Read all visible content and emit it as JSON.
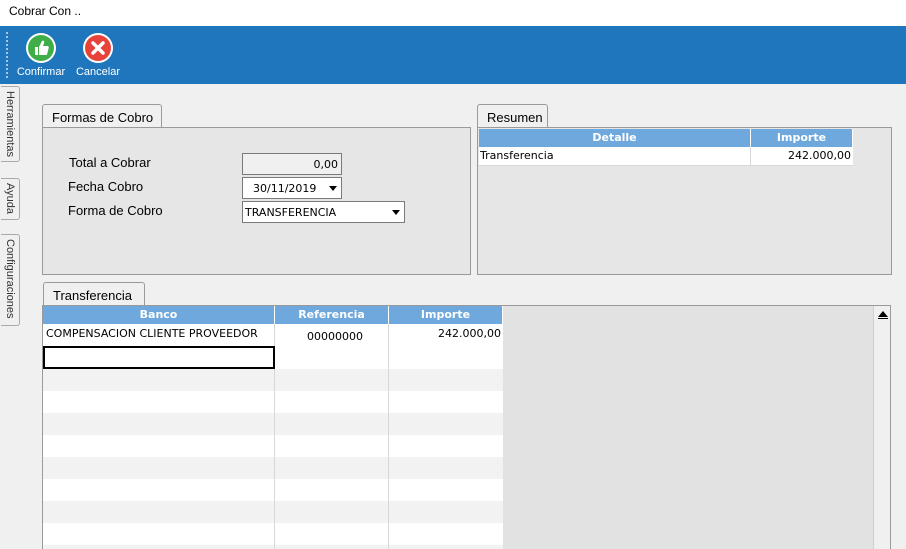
{
  "window": {
    "title": "Cobrar Con .."
  },
  "toolbar": {
    "confirm_label": "Confirmar",
    "cancel_label": "Cancelar"
  },
  "side_tabs": [
    "Herramientas",
    "Ayuda",
    "Configuraciones"
  ],
  "formas": {
    "tab_label": "Formas de Cobro",
    "total_label": "Total a Cobrar",
    "total_value": "0,00",
    "fecha_label": "Fecha Cobro",
    "fecha_value": "30/11/2019",
    "forma_label": "Forma de Cobro",
    "forma_value": "TRANSFERENCIA"
  },
  "resumen": {
    "tab_label": "Resumen",
    "columns": [
      "Detalle",
      "Importe"
    ],
    "rows": [
      {
        "detalle": "Transferencia",
        "importe": "242.000,00"
      }
    ]
  },
  "transferencia": {
    "tab_label": "Transferencia",
    "columns": [
      "Banco",
      "Referencia",
      "Importe"
    ],
    "rows": [
      {
        "banco": "COMPENSACION CLIENTE PROVEEDOR",
        "referencia": "00000000",
        "importe": "242.000,00"
      }
    ]
  },
  "colors": {
    "toolbar": "#1f76bd",
    "grid_header": "#6fa8dc",
    "confirm_icon": "#3fae49",
    "cancel_icon": "#e8423b"
  }
}
